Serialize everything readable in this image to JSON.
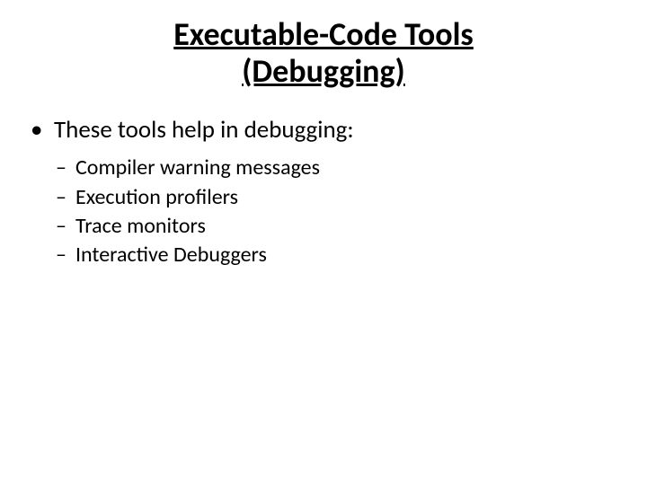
{
  "title_line1": "Executable-Code Tools",
  "title_line2": "(Debugging)",
  "bullet": "These tools help in debugging:",
  "sub": [
    "Compiler warning messages",
    "Execution profilers",
    "Trace monitors",
    "Interactive Debuggers"
  ]
}
